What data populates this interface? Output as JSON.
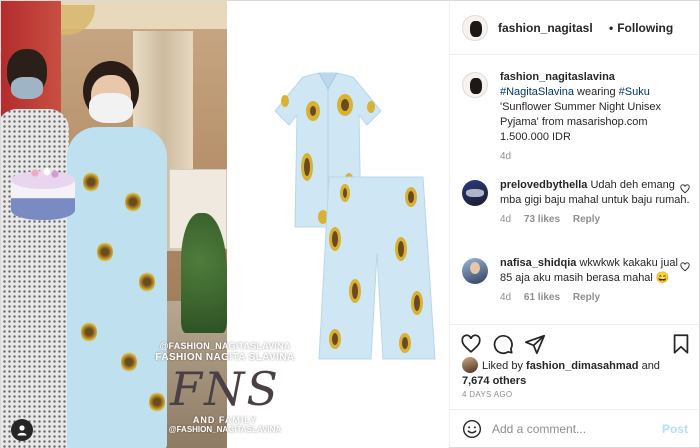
{
  "post": {
    "author": "fashion_nagitasl",
    "separator": "•",
    "follow_label": "Following",
    "caption": {
      "user": "fashion_nagitaslavina",
      "tag1": "#NagitaSlavina",
      "text1": " wearing ",
      "tag2": "#Suku",
      "text2": " 'Sunflower Summer Night Unisex Pyjama' from masarishop.com 1.500.000 IDR",
      "age": "4d"
    },
    "comments": [
      {
        "user": "prelovedbythella",
        "text": "Udah deh emang mba gigi baju mahal untuk baju rumah.",
        "age": "4d",
        "likes": "73 likes",
        "reply": "Reply"
      },
      {
        "user": "nafisa_shidqia",
        "text": "wkwkwk kakaku jual 85 aja aku masih berasa mahal 😄",
        "age": "4d",
        "likes": "61 likes",
        "reply": "Reply"
      }
    ],
    "likes": {
      "prefix": "Liked by ",
      "user": "fashion_dimasahmad",
      "and": " and",
      "others": "7,674 others"
    },
    "timestamp": "4 DAYS AGO",
    "comment_input": {
      "placeholder": "Add a comment...",
      "post_label": "Post"
    }
  },
  "watermark": {
    "handle_top": "@FASHION_NAGITASLAVINA",
    "brand": "FASHION NAGITA SLAVINA",
    "monogram": "FNS",
    "family": "AND FAMILY",
    "handle_bottom": "@FASHION_NAGITASLAVINA"
  },
  "icons": [
    "heart-icon",
    "comment-icon",
    "share-icon",
    "bookmark-icon",
    "smile-icon",
    "user-tag-icon"
  ],
  "colors": {
    "link": "#00376b",
    "muted": "#8e8e8e",
    "post_disabled": "#b2dffc",
    "pyjama_blue": "#cfe7f5",
    "sunflower": "#d8b233"
  }
}
